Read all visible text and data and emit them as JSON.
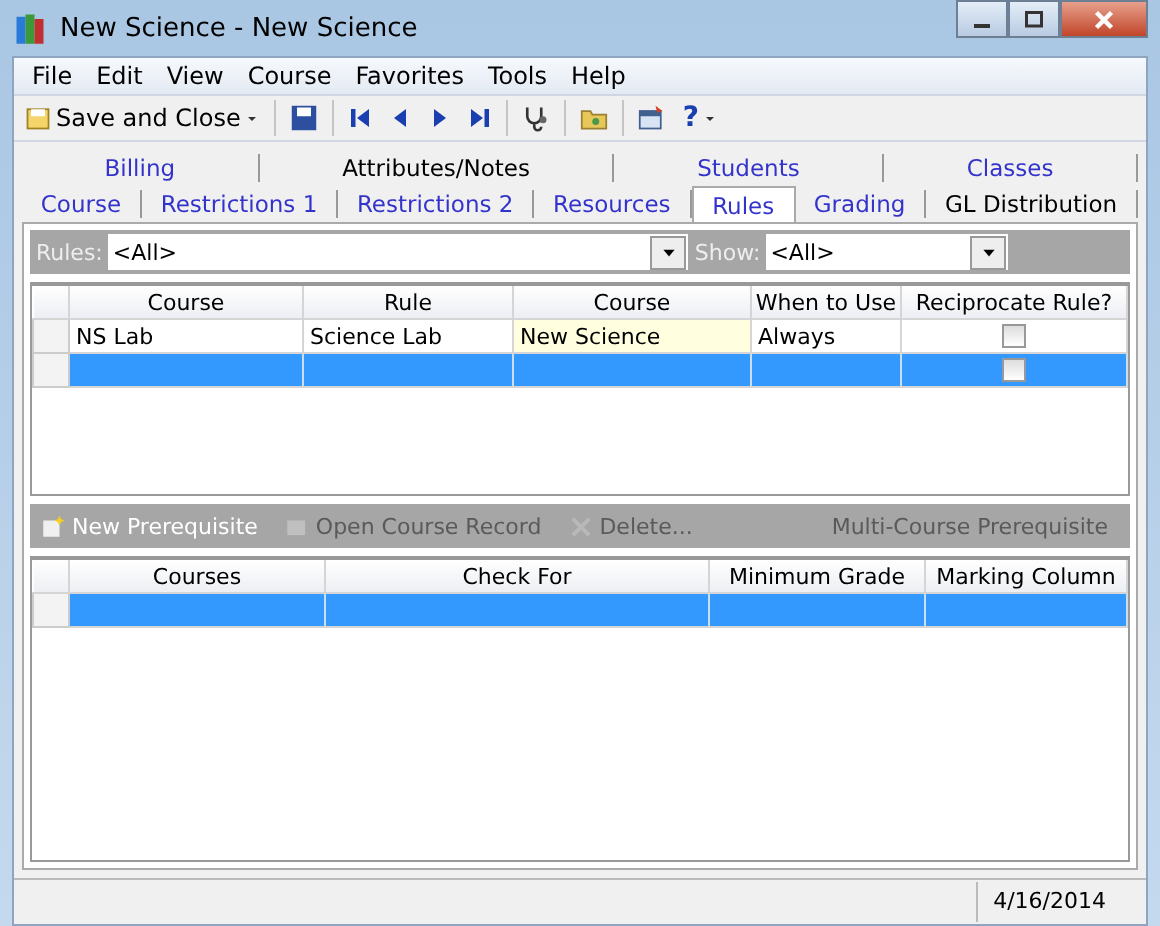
{
  "window": {
    "title": "New Science - New Science"
  },
  "menu": [
    "File",
    "Edit",
    "View",
    "Course",
    "Favorites",
    "Tools",
    "Help"
  ],
  "toolbar": {
    "save_close": "Save and Close",
    "help": "?"
  },
  "tab_rows": [
    [
      {
        "label": "Billing",
        "kind": "link",
        "selected": false
      },
      {
        "label": "Attributes/Notes",
        "kind": "plain",
        "selected": false
      },
      {
        "label": "Students",
        "kind": "link",
        "selected": false
      },
      {
        "label": "Classes",
        "kind": "link",
        "selected": false
      }
    ],
    [
      {
        "label": "Course",
        "kind": "link",
        "selected": false
      },
      {
        "label": "Restrictions 1",
        "kind": "link",
        "selected": false
      },
      {
        "label": "Restrictions 2",
        "kind": "link",
        "selected": false
      },
      {
        "label": "Resources",
        "kind": "link",
        "selected": false
      },
      {
        "label": "Rules",
        "kind": "link",
        "selected": true
      },
      {
        "label": "Grading",
        "kind": "link",
        "selected": false
      },
      {
        "label": "GL Distribution",
        "kind": "plain",
        "selected": false
      }
    ]
  ],
  "filters": [
    {
      "label": "Rules:",
      "value": "<All>"
    },
    {
      "label": "Show:",
      "value": "<All>"
    }
  ],
  "rules_table": {
    "columns": [
      "Course",
      "Rule",
      "Course",
      "When to Use",
      "Reciprocate Rule?"
    ],
    "rows": [
      {
        "cells": [
          "NS Lab",
          "Science Lab",
          "New Science",
          "Always"
        ],
        "reciprocate": false,
        "selected": false
      },
      {
        "cells": [
          "",
          "",
          "",
          ""
        ],
        "reciprocate": false,
        "selected": true
      }
    ]
  },
  "prereq_actions": [
    {
      "label": "New Prerequisite",
      "disabled": false
    },
    {
      "label": "Open Course Record",
      "disabled": true
    },
    {
      "label": "Delete...",
      "disabled": true
    },
    {
      "label": "Multi-Course Prerequisite",
      "disabled": true
    }
  ],
  "prereq_table": {
    "columns": [
      "Courses",
      "Check For",
      "Minimum Grade",
      "Marking Column"
    ],
    "rows": [
      {
        "selected": true
      }
    ]
  },
  "status_bar": {
    "date": "4/16/2014"
  }
}
